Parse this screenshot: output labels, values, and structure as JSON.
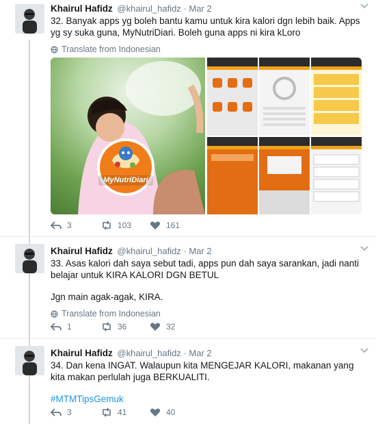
{
  "author": {
    "name": "Khairul Hafidz",
    "handle": "@khairul_hafidz"
  },
  "separator": "·",
  "colors": {
    "link": "#1b95e0",
    "muted": "#657786",
    "thread_line": "#ccd6dd",
    "app_orange": "#e26d12"
  },
  "tweets": [
    {
      "time": "Mar 2",
      "lines": [
        "32. Banyak apps yg boleh bantu kamu untuk kira kalori dgn lebih baik. Apps yg sy suka guna, MyNutriDiari. Boleh guna apps ni kira kLoro"
      ],
      "translate": "Translate from Indonesian",
      "media": {
        "logo_text": "MyNutriDiari",
        "screens": 6
      },
      "replies": "3",
      "retweets": "103",
      "likes": "161"
    },
    {
      "time": "Mar 2",
      "lines": [
        "33. Asas kalori dah saya sebut tadi, apps pun dah saya sarankan, jadi nanti belajar untuk KIRA KALORI DGN BETUL",
        "Jgn main agak-agak, KIRA."
      ],
      "translate": "Translate from Indonesian",
      "replies": "1",
      "retweets": "36",
      "likes": "32"
    },
    {
      "time": "Mar 2",
      "lines": [
        "34. Dan kena INGAT. Walaupun kita MENGEJAR KALORI, makanan yang kita makan perlulah juga BERKUALITI.",
        "#MTMTipsGemuk"
      ],
      "replies": "3",
      "retweets": "41",
      "likes": "40"
    }
  ],
  "icons": [
    "reply-icon",
    "retweet-icon",
    "like-icon",
    "globe-icon",
    "chevron-down-icon"
  ]
}
